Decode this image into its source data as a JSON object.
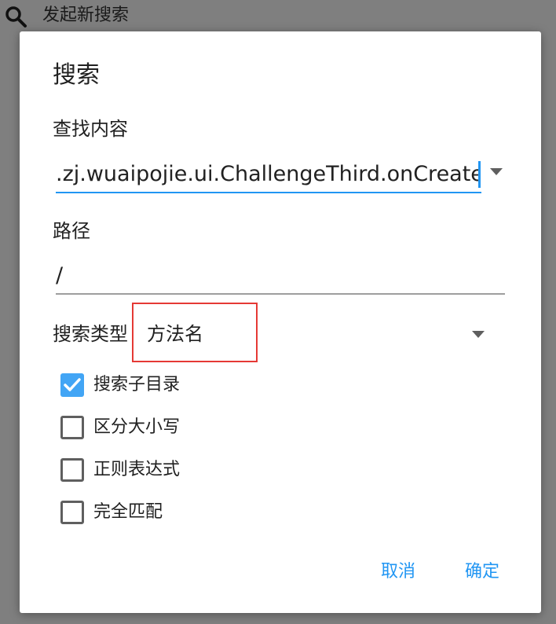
{
  "topbar": {
    "icon": "search-icon",
    "title": "发起新搜索"
  },
  "dialog": {
    "title": "搜索",
    "find_label": "查找内容",
    "find_value": ".zj.wuaipojie.ui.ChallengeThird.onCreate",
    "path_label": "路径",
    "path_value": "/",
    "type_label": "搜索类型",
    "type_value": "方法名",
    "options": [
      {
        "label": "搜索子目录",
        "checked": true
      },
      {
        "label": "区分大小写",
        "checked": false
      },
      {
        "label": "正则表达式",
        "checked": false
      },
      {
        "label": "完全匹配",
        "checked": false
      }
    ],
    "cancel_label": "取消",
    "ok_label": "确定"
  },
  "colors": {
    "accent": "#2196f3",
    "checkbox_checked": "#42a5f5",
    "highlight_box": "#e53935",
    "overlay": "#7f7f7f"
  }
}
